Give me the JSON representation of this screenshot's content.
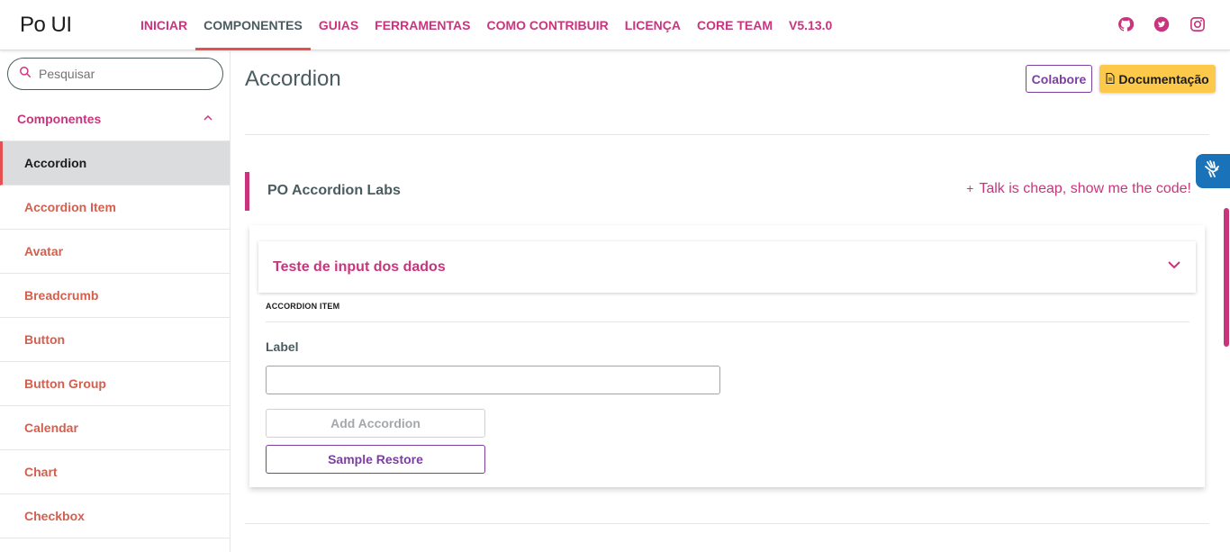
{
  "header": {
    "logo": "Po UI",
    "nav": [
      {
        "label": "INICIAR",
        "active": false
      },
      {
        "label": "COMPONENTES",
        "active": true
      },
      {
        "label": "GUIAS",
        "active": false
      },
      {
        "label": "FERRAMENTAS",
        "active": false
      },
      {
        "label": "COMO CONTRIBUIR",
        "active": false
      },
      {
        "label": "LICENÇA",
        "active": false
      },
      {
        "label": "CORE TEAM",
        "active": false
      },
      {
        "label": "V5.13.0",
        "active": false
      }
    ],
    "social_icons": [
      "github-icon",
      "twitter-icon",
      "instagram-icon"
    ]
  },
  "sidebar": {
    "search_placeholder": "Pesquisar",
    "group_label": "Componentes",
    "items": [
      {
        "label": "Accordion",
        "active": true
      },
      {
        "label": "Accordion Item",
        "active": false
      },
      {
        "label": "Avatar",
        "active": false
      },
      {
        "label": "Breadcrumb",
        "active": false
      },
      {
        "label": "Button",
        "active": false
      },
      {
        "label": "Button Group",
        "active": false
      },
      {
        "label": "Calendar",
        "active": false
      },
      {
        "label": "Chart",
        "active": false
      },
      {
        "label": "Checkbox",
        "active": false
      }
    ]
  },
  "main": {
    "title": "Accordion",
    "collab_button": "Colabore",
    "doc_button": "Documentação",
    "labs_title": "PO Accordion Labs",
    "code_link": "Talk is cheap, show me the code!",
    "code_link_prefix": "+",
    "accordion_title": "Teste de input dos dados",
    "accordion_item_label": "ACCORDION ITEM",
    "field_label": "Label",
    "field_value": "",
    "add_button": "Add Accordion",
    "restore_button": "Sample Restore"
  },
  "colors": {
    "primary": "#c9357d",
    "accent_red": "#e75050",
    "purple": "#7a3fa1",
    "yellow": "#fcc94a",
    "a11y_blue": "#1a73b8"
  }
}
